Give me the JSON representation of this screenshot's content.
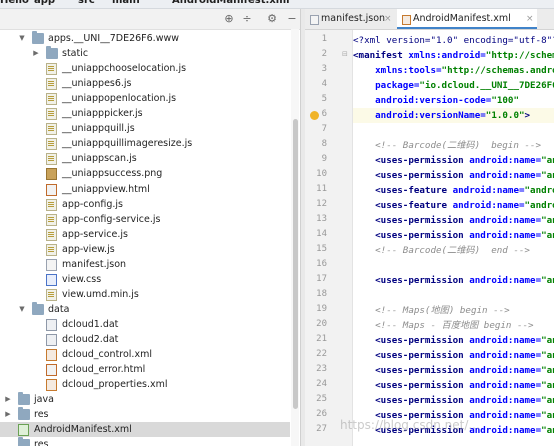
{
  "crumbs": [
    {
      "label": "Hello"
    },
    {
      "label": "app"
    },
    {
      "label": "src"
    },
    {
      "label": "main"
    },
    {
      "label": "AndroidManifest.xml"
    }
  ],
  "panel": {
    "header_icons": [
      "crosshair-icon",
      "split-icon",
      "gear-icon",
      "minimize-icon"
    ]
  },
  "tree": [
    {
      "depth": 1,
      "arrow": "down",
      "icon": "folder",
      "label": "apps.__UNI__7DE26F6.www"
    },
    {
      "depth": 2,
      "arrow": "right",
      "icon": "folder",
      "label": "static"
    },
    {
      "depth": 2,
      "arrow": "",
      "icon": "js",
      "label": "__uniappchooselocation.js"
    },
    {
      "depth": 2,
      "arrow": "",
      "icon": "js",
      "label": "__uniappes6.js"
    },
    {
      "depth": 2,
      "arrow": "",
      "icon": "js",
      "label": "__uniappopenlocation.js"
    },
    {
      "depth": 2,
      "arrow": "",
      "icon": "js",
      "label": "__uniapppicker.js"
    },
    {
      "depth": 2,
      "arrow": "",
      "icon": "js",
      "label": "__uniappquill.js"
    },
    {
      "depth": 2,
      "arrow": "",
      "icon": "js",
      "label": "__uniappquillimageresize.js"
    },
    {
      "depth": 2,
      "arrow": "",
      "icon": "js",
      "label": "__uniappscan.js"
    },
    {
      "depth": 2,
      "arrow": "",
      "icon": "png",
      "label": "__uniappsuccess.png"
    },
    {
      "depth": 2,
      "arrow": "",
      "icon": "html",
      "label": "__uniappview.html"
    },
    {
      "depth": 2,
      "arrow": "",
      "icon": "js",
      "label": "app-config.js"
    },
    {
      "depth": 2,
      "arrow": "",
      "icon": "js",
      "label": "app-config-service.js"
    },
    {
      "depth": 2,
      "arrow": "",
      "icon": "js",
      "label": "app-service.js"
    },
    {
      "depth": 2,
      "arrow": "",
      "icon": "js",
      "label": "app-view.js"
    },
    {
      "depth": 2,
      "arrow": "",
      "icon": "json",
      "label": "manifest.json"
    },
    {
      "depth": 2,
      "arrow": "",
      "icon": "css",
      "label": "view.css"
    },
    {
      "depth": 2,
      "arrow": "",
      "icon": "js",
      "label": "view.umd.min.js"
    },
    {
      "depth": 1,
      "arrow": "down",
      "icon": "folder",
      "label": "data"
    },
    {
      "depth": 2,
      "arrow": "",
      "icon": "dat",
      "label": "dcloud1.dat"
    },
    {
      "depth": 2,
      "arrow": "",
      "icon": "dat",
      "label": "dcloud2.dat"
    },
    {
      "depth": 2,
      "arrow": "",
      "icon": "xml",
      "label": "dcloud_control.xml"
    },
    {
      "depth": 2,
      "arrow": "",
      "icon": "html",
      "label": "dcloud_error.html"
    },
    {
      "depth": 2,
      "arrow": "",
      "icon": "xml",
      "label": "dcloud_properties.xml"
    },
    {
      "depth": 0,
      "arrow": "right",
      "icon": "folder",
      "label": "java"
    },
    {
      "depth": 0,
      "arrow": "right",
      "icon": "folder",
      "label": "res"
    },
    {
      "depth": 0,
      "arrow": "",
      "icon": "manifest",
      "label": "AndroidManifest.xml",
      "selected": true
    },
    {
      "depth": 0,
      "arrow": "",
      "icon": "folder",
      "label": "res"
    }
  ],
  "tabs": [
    {
      "label": "manifest.json",
      "icon": "json",
      "active": false
    },
    {
      "label": "AndroidManifest.xml",
      "icon": "xml",
      "active": true
    }
  ],
  "code_lines": [
    {
      "n": "1",
      "tokens": [
        [
          "pi",
          "<?xml version=\"1.0\" encoding=\"utf-8\"?>"
        ]
      ]
    },
    {
      "n": "2",
      "tokens": [
        [
          "tag",
          "<manifest "
        ],
        [
          "attr",
          "xmlns:android="
        ],
        [
          "str",
          "\"http://schemas"
        ]
      ]
    },
    {
      "n": "3",
      "tokens": [
        [
          "plain",
          "    "
        ],
        [
          "attr",
          "xmlns:tools="
        ],
        [
          "str",
          "\"http://schemas.androi"
        ]
      ]
    },
    {
      "n": "4",
      "tokens": [
        [
          "plain",
          "    "
        ],
        [
          "attr",
          "package="
        ],
        [
          "str",
          "\"io.dcloud.__UNI__7DE26F6\""
        ]
      ]
    },
    {
      "n": "5",
      "tokens": [
        [
          "plain",
          "    "
        ],
        [
          "attr",
          "android:version-code="
        ],
        [
          "str",
          "\"100\""
        ]
      ]
    },
    {
      "n": "6",
      "tokens": [
        [
          "plain",
          "    "
        ],
        [
          "attr",
          "android:versionName="
        ],
        [
          "str",
          "\"1.0.0\""
        ],
        [
          "tag",
          ">"
        ]
      ],
      "current": true,
      "bulb": true
    },
    {
      "n": "7",
      "tokens": []
    },
    {
      "n": "8",
      "tokens": [
        [
          "plain",
          "    "
        ],
        [
          "cmt",
          "<!-- Barcode(二维码)  begin -->"
        ]
      ]
    },
    {
      "n": "9",
      "tokens": [
        [
          "plain",
          "    "
        ],
        [
          "tag",
          "<uses-permission "
        ],
        [
          "attr",
          "android:name="
        ],
        [
          "str",
          "\"and"
        ]
      ]
    },
    {
      "n": "10",
      "tokens": [
        [
          "plain",
          "    "
        ],
        [
          "tag",
          "<uses-permission "
        ],
        [
          "attr",
          "android:name="
        ],
        [
          "str",
          "\"and"
        ]
      ]
    },
    {
      "n": "11",
      "tokens": [
        [
          "plain",
          "    "
        ],
        [
          "tag",
          "<uses-feature "
        ],
        [
          "attr",
          "android:name="
        ],
        [
          "str",
          "\"androi"
        ]
      ]
    },
    {
      "n": "12",
      "tokens": [
        [
          "plain",
          "    "
        ],
        [
          "tag",
          "<uses-feature "
        ],
        [
          "attr",
          "android:name="
        ],
        [
          "str",
          "\"androi"
        ]
      ]
    },
    {
      "n": "13",
      "tokens": [
        [
          "plain",
          "    "
        ],
        [
          "tag",
          "<uses-permission "
        ],
        [
          "attr",
          "android:name="
        ],
        [
          "str",
          "\"and"
        ]
      ]
    },
    {
      "n": "14",
      "tokens": [
        [
          "plain",
          "    "
        ],
        [
          "tag",
          "<uses-permission "
        ],
        [
          "attr",
          "android:name="
        ],
        [
          "str",
          "\"and"
        ]
      ]
    },
    {
      "n": "15",
      "tokens": [
        [
          "plain",
          "    "
        ],
        [
          "cmt",
          "<!-- Barcode(二维码)  end -->"
        ]
      ]
    },
    {
      "n": "16",
      "tokens": []
    },
    {
      "n": "17",
      "tokens": [
        [
          "plain",
          "    "
        ],
        [
          "tag",
          "<uses-permission "
        ],
        [
          "attr",
          "android:name="
        ],
        [
          "str",
          "\"and"
        ]
      ]
    },
    {
      "n": "18",
      "tokens": []
    },
    {
      "n": "19",
      "tokens": [
        [
          "plain",
          "    "
        ],
        [
          "cmt",
          "<!-- Maps(地图) begin -->"
        ]
      ]
    },
    {
      "n": "20",
      "tokens": [
        [
          "plain",
          "    "
        ],
        [
          "cmt",
          "<!-- Maps - 百度地图 begin -->"
        ]
      ]
    },
    {
      "n": "21",
      "tokens": [
        [
          "plain",
          "    "
        ],
        [
          "tag",
          "<uses-permission "
        ],
        [
          "attr",
          "android:name="
        ],
        [
          "str",
          "\"and"
        ]
      ]
    },
    {
      "n": "22",
      "tokens": [
        [
          "plain",
          "    "
        ],
        [
          "tag",
          "<uses-permission "
        ],
        [
          "attr",
          "android:name="
        ],
        [
          "str",
          "\"and"
        ]
      ]
    },
    {
      "n": "23",
      "tokens": [
        [
          "plain",
          "    "
        ],
        [
          "tag",
          "<uses-permission "
        ],
        [
          "attr",
          "android:name="
        ],
        [
          "str",
          "\"and"
        ]
      ]
    },
    {
      "n": "24",
      "tokens": [
        [
          "plain",
          "    "
        ],
        [
          "tag",
          "<uses-permission "
        ],
        [
          "attr",
          "android:name="
        ],
        [
          "str",
          "\"and"
        ]
      ]
    },
    {
      "n": "25",
      "tokens": [
        [
          "plain",
          "    "
        ],
        [
          "tag",
          "<uses-permission "
        ],
        [
          "attr",
          "android:name="
        ],
        [
          "str",
          "\"and"
        ]
      ]
    },
    {
      "n": "26",
      "tokens": [
        [
          "plain",
          "    "
        ],
        [
          "tag",
          "<uses-permission "
        ],
        [
          "attr",
          "android:name="
        ],
        [
          "str",
          "\"and"
        ]
      ]
    },
    {
      "n": "27",
      "tokens": [
        [
          "plain",
          "    "
        ],
        [
          "tag",
          "<uses-permission "
        ],
        [
          "attr",
          "android:name="
        ],
        [
          "str",
          "\"and"
        ]
      ]
    }
  ],
  "watermark": "https://blog.csdn.net/..."
}
